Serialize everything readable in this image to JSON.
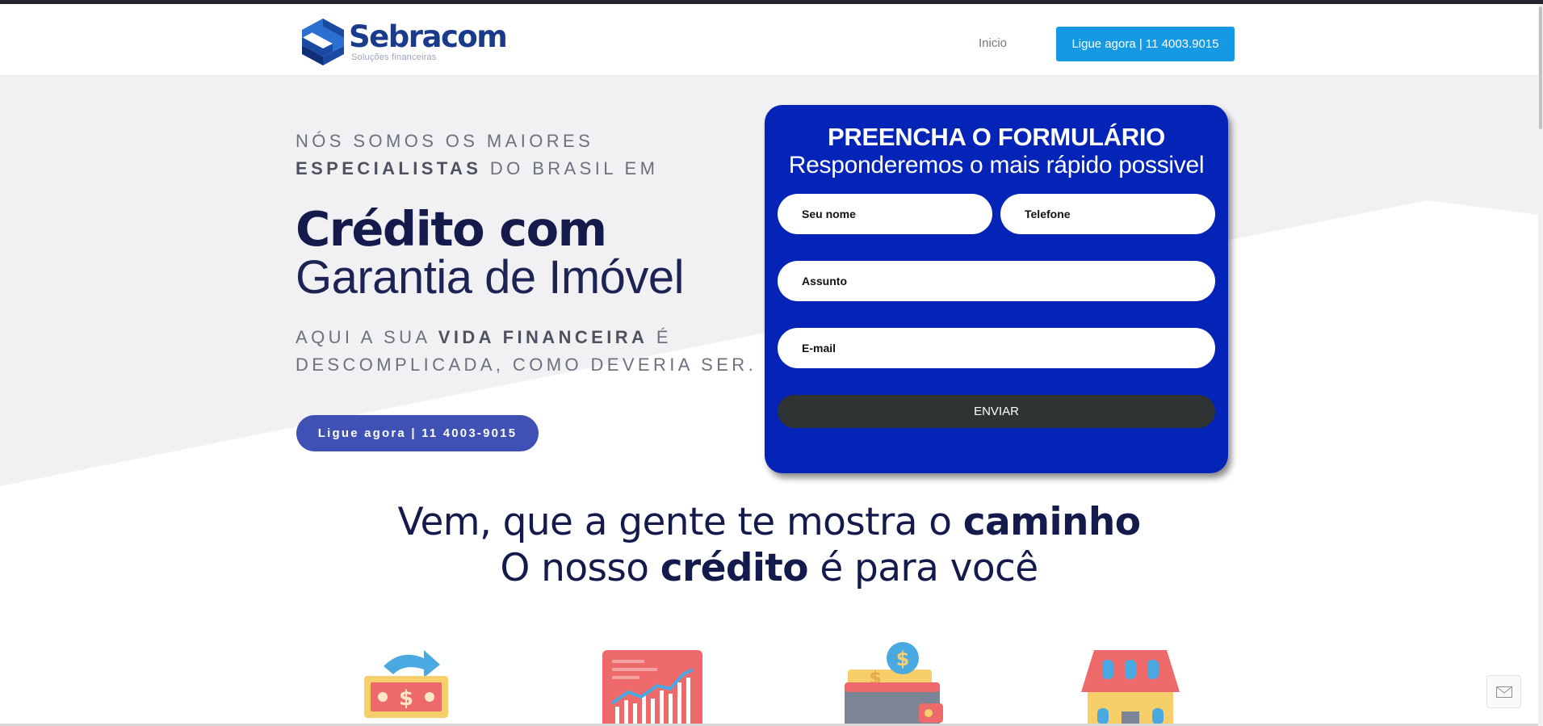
{
  "header": {
    "logo_name": "Sebracom",
    "logo_tagline": "Soluções financeiras",
    "nav_home": "Inicio",
    "call_button": "Ligue agora | 11 4003.9015"
  },
  "hero": {
    "eyebrow_line1": "NÓS SOMOS OS MAIORES",
    "eyebrow_bold": "ESPECIALISTAS",
    "eyebrow_rest": " DO BRASIL EM",
    "title_bold": "Crédito com",
    "title_light": "Garantia de Imóvel",
    "sub_start": "AQUI A SUA ",
    "sub_bold": "VIDA FINANCEIRA",
    "sub_end": " É",
    "sub_line2": "DESCOMPLICADA, COMO DEVERIA SER.",
    "cta_button": "Ligue agora | 11 4003-9015"
  },
  "form": {
    "title": "PREENCHA O FORMULÁRIO",
    "subtitle": "Responderemos o mais rápido possivel",
    "name_placeholder": "Seu nome",
    "phone_placeholder": "Telefone",
    "subject_placeholder": "Assunto",
    "email_placeholder": "E-mail",
    "submit_label": "ENVIAR"
  },
  "tagline": {
    "line1_start": "Vem, que a gente te mostra o ",
    "line1_bold": "caminho",
    "line2_start": "O nosso ",
    "line2_bold": "crédito",
    "line2_end": " é para você"
  },
  "features": {
    "icons": [
      "money-transfer-icon",
      "growth-chart-icon",
      "wallet-coins-icon",
      "house-icon"
    ]
  },
  "colors": {
    "brand_blue": "#1a3a8c",
    "call_button": "#1699e4",
    "form_background": "#0324b6",
    "hero_button": "#3f51b5",
    "submit_button": "#2f3333",
    "heading_navy": "#141a4c"
  }
}
